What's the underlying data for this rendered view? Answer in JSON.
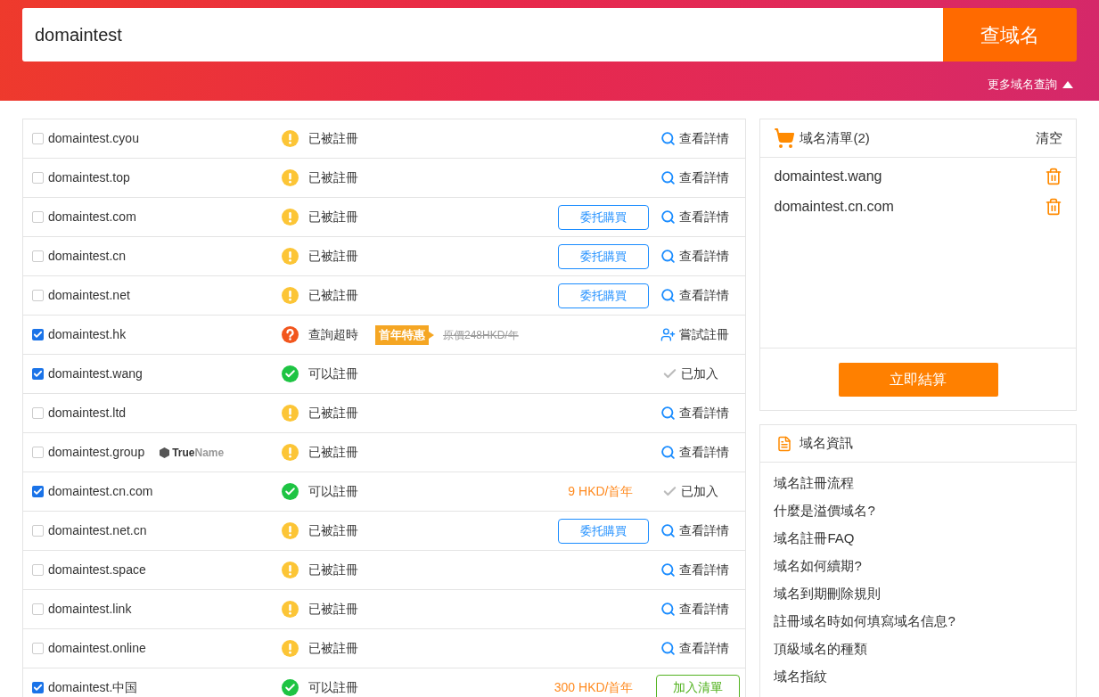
{
  "search": {
    "value": "domaintest",
    "button": "查域名",
    "more_link": "更多域名查詢"
  },
  "results": [
    {
      "domain": "domaintest.cyou",
      "checked": false,
      "status": {
        "kind": "taken",
        "text": "已被註冊"
      },
      "action": {
        "kind": "details",
        "text": "查看詳情"
      }
    },
    {
      "domain": "domaintest.top",
      "checked": false,
      "status": {
        "kind": "taken",
        "text": "已被註冊"
      },
      "action": {
        "kind": "details",
        "text": "查看詳情"
      }
    },
    {
      "domain": "domaintest.com",
      "checked": false,
      "status": {
        "kind": "taken",
        "text": "已被註冊"
      },
      "broker": "委托購買",
      "action": {
        "kind": "details",
        "text": "查看詳情"
      }
    },
    {
      "domain": "domaintest.cn",
      "checked": false,
      "status": {
        "kind": "taken",
        "text": "已被註冊"
      },
      "broker": "委托購買",
      "action": {
        "kind": "details",
        "text": "查看詳情"
      }
    },
    {
      "domain": "domaintest.net",
      "checked": false,
      "status": {
        "kind": "taken",
        "text": "已被註冊"
      },
      "broker": "委托購買",
      "action": {
        "kind": "details",
        "text": "查看詳情"
      }
    },
    {
      "domain": "domaintest.hk",
      "checked": true,
      "status": {
        "kind": "timeout",
        "text": "查詢超時"
      },
      "promo": "首年特惠",
      "original_price": "原價248HKD/年",
      "action": {
        "kind": "try_register",
        "text": "嘗試註冊"
      }
    },
    {
      "domain": "domaintest.wang",
      "checked": true,
      "status": {
        "kind": "available",
        "text": "可以註冊"
      },
      "action": {
        "kind": "added",
        "text": "已加入"
      }
    },
    {
      "domain": "domaintest.ltd",
      "checked": false,
      "status": {
        "kind": "taken",
        "text": "已被註冊"
      },
      "action": {
        "kind": "details",
        "text": "查看詳情"
      }
    },
    {
      "domain": "domaintest.group",
      "checked": false,
      "brand": {
        "bold": "True",
        "light": "Name"
      },
      "status": {
        "kind": "taken",
        "text": "已被註冊"
      },
      "action": {
        "kind": "details",
        "text": "查看詳情"
      }
    },
    {
      "domain": "domaintest.cn.com",
      "checked": true,
      "status": {
        "kind": "available",
        "text": "可以註冊"
      },
      "price": "9 HKD/首年",
      "action": {
        "kind": "added",
        "text": "已加入"
      }
    },
    {
      "domain": "domaintest.net.cn",
      "checked": false,
      "status": {
        "kind": "taken",
        "text": "已被註冊"
      },
      "broker": "委托購買",
      "action": {
        "kind": "details",
        "text": "查看詳情"
      }
    },
    {
      "domain": "domaintest.space",
      "checked": false,
      "status": {
        "kind": "taken",
        "text": "已被註冊"
      },
      "action": {
        "kind": "details",
        "text": "查看詳情"
      }
    },
    {
      "domain": "domaintest.link",
      "checked": false,
      "status": {
        "kind": "taken",
        "text": "已被註冊"
      },
      "action": {
        "kind": "details",
        "text": "查看詳情"
      }
    },
    {
      "domain": "domaintest.online",
      "checked": false,
      "status": {
        "kind": "taken",
        "text": "已被註冊"
      },
      "action": {
        "kind": "details",
        "text": "查看詳情"
      }
    },
    {
      "domain": "domaintest.中国",
      "checked": true,
      "status": {
        "kind": "available",
        "text": "可以註冊"
      },
      "price": "300 HKD/首年",
      "action": {
        "kind": "add",
        "text": "加入清單"
      }
    }
  ],
  "cart": {
    "title": "域名清單(2)",
    "clear": "清空",
    "items": [
      "domaintest.wang",
      "domaintest.cn.com"
    ],
    "checkout": "立即結算"
  },
  "info": {
    "title": "域名資訊",
    "links": [
      "域名註冊流程",
      "什麼是溢價域名?",
      "域名註冊FAQ",
      "域名如何續期?",
      "域名到期刪除規則",
      "註冊域名時如何填寫域名信息?",
      "頂級域名的種類",
      "域名指紋"
    ]
  }
}
